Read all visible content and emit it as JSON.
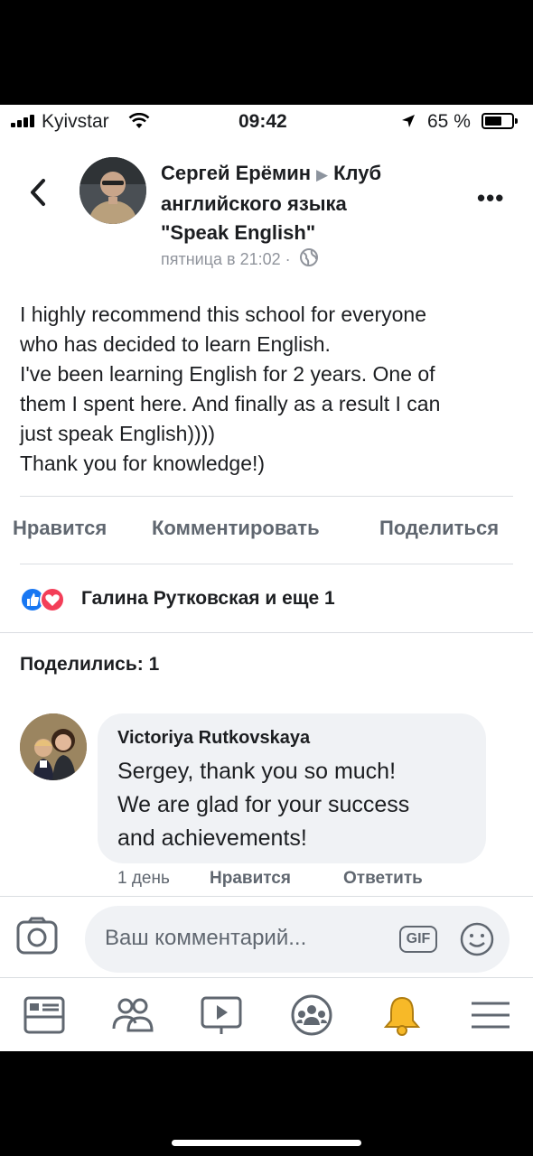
{
  "status_bar": {
    "carrier": "Kyivstar",
    "time": "09:42",
    "battery": "65 %",
    "battery_level": 0.65
  },
  "header": {
    "author": "Сергей Ерёмин",
    "group_line1": "Клуб",
    "group_line2": "английского языка",
    "group_line3": "\"Speak English\"",
    "timestamp": "пятница в 21:02 ·"
  },
  "post": {
    "lines": [
      "I highly recommend this school for everyone",
      "who has decided to learn English.",
      "I've been learning English for 2 years. One of",
      "them I spent here. And finally as a result I can",
      "just speak English))))",
      "Thank you for knowledge!)"
    ]
  },
  "actions": {
    "like": "Нравится",
    "comment": "Комментировать",
    "share": "Поделиться"
  },
  "reactions": {
    "text": "Галина Рутковская и еще 1"
  },
  "shares": {
    "text": "Поделились: 1"
  },
  "comment": {
    "author": "Victoriya Rutkovskaya",
    "lines": [
      "Sergey, thank you so much!",
      "We are glad for your success",
      "and achievements!"
    ],
    "age": "1 день",
    "like": "Нравится",
    "reply": "Ответить"
  },
  "composer": {
    "placeholder": "Ваш комментарий...",
    "gif": "GIF"
  },
  "colors": {
    "like_blue": "#1877f2",
    "love_red": "#f33e58",
    "notification_yellow": "#f7b928",
    "text_gray": "#606770"
  },
  "icons": {
    "tabs": [
      "news-feed-icon",
      "friends-icon",
      "watch-icon",
      "groups-icon",
      "notifications-icon",
      "menu-icon"
    ]
  }
}
